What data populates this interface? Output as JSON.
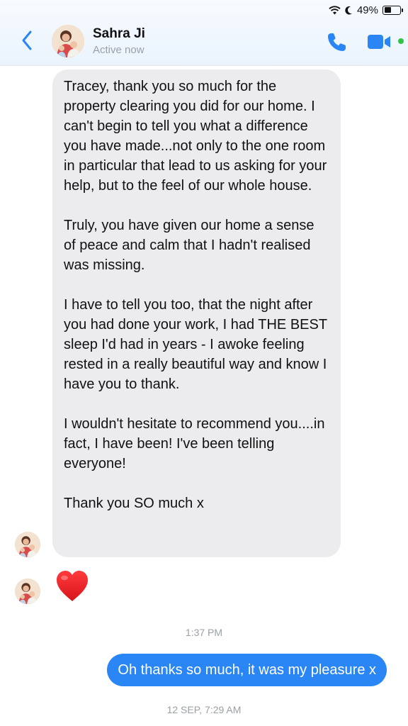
{
  "status_bar": {
    "battery": "49%",
    "battery_level": 0.49,
    "icons": [
      "wifi-icon",
      "moon-icon",
      "battery-icon"
    ]
  },
  "header": {
    "back_icon": "chevron-left-icon",
    "contact_name": "Sahra Ji",
    "contact_status": "Active now",
    "actions": [
      "phone-icon",
      "video-camera-icon"
    ],
    "accent_color": "#2a86f4",
    "online_color": "#31c24a"
  },
  "messages": {
    "incoming": {
      "paragraphs": [
        "Tracey, thank you so much for the property clearing you did for our home. I can't begin to tell you what a difference you have  made...not only to the one room in particular that lead to us asking for your help, but to the feel of our whole house.",
        "Truly, you have given our home a sense of peace and calm that I hadn't realised was missing.",
        "I have to tell you too, that the night after you had done your work, I had THE BEST sleep I'd had  in years - I awoke feeling rested in a really beautiful way and know I have you to thank.",
        "I wouldn't hesitate to recommend you....in fact, I have been! I've been telling everyone!",
        "Thank you SO much x"
      ],
      "bubble_color": "#ececef"
    },
    "reaction": {
      "emoji": "red-heart-icon"
    },
    "timestamp_1": "1:37 PM",
    "outgoing": {
      "text": "Oh thanks so much, it was my pleasure x",
      "bubble_color": "#2a86f4"
    },
    "timestamp_2": "12 SEP, 7:29 AM"
  }
}
